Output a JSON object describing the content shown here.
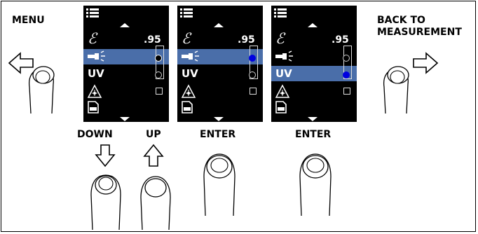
{
  "labels": {
    "menu": "MENU",
    "back": "BACK TO\nMEASUREMENT",
    "down": "DOWN",
    "up": "UP",
    "enter1": "ENTER",
    "enter2": "ENTER"
  },
  "screens": [
    {
      "epsilon": "ℰ",
      "value": ".95",
      "uv": "UV",
      "selected_row": "flashlight",
      "radio": [
        "filled",
        "empty"
      ]
    },
    {
      "epsilon": "ℰ",
      "value": ".95",
      "uv": "UV",
      "selected_row": "flashlight",
      "radio": [
        "blue",
        "empty"
      ]
    },
    {
      "epsilon": "ℰ",
      "value": ".95",
      "uv": "UV",
      "selected_row": "uv",
      "radio": [
        "empty",
        "blue"
      ]
    }
  ],
  "colors": {
    "highlight": "#4a6ea9",
    "radio_selected": "#0000e0",
    "screen_bg": "#000000"
  },
  "icons": [
    "menu-icon",
    "emissivity-icon",
    "flashlight-icon",
    "laser-icon",
    "sd-card-icon",
    "left-arrow-icon",
    "right-arrow-icon",
    "down-arrow-icon",
    "up-arrow-icon",
    "finger-press-icon"
  ]
}
